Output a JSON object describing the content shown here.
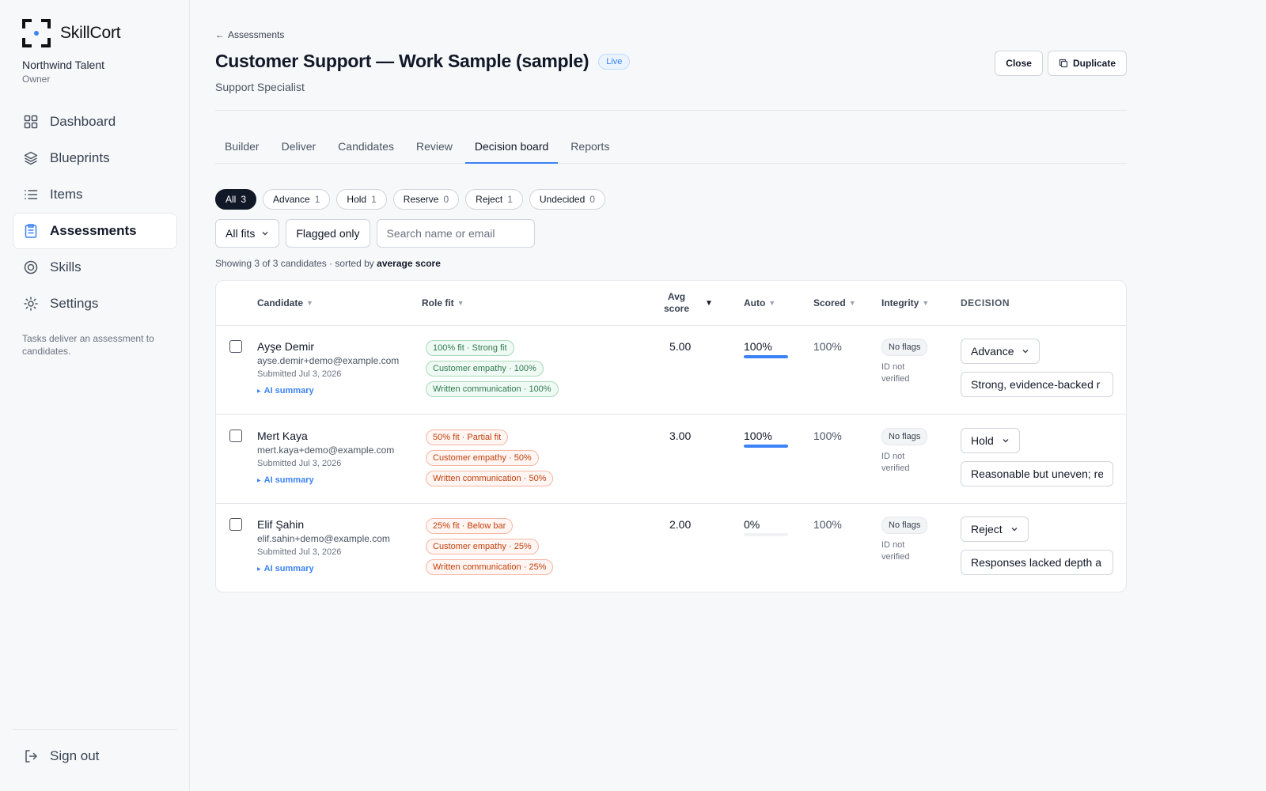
{
  "app": {
    "name": "SkillCort",
    "org_name": "Northwind Talent",
    "org_role": "Owner",
    "accent_color": "#3b82f6"
  },
  "sidebar": {
    "items": [
      {
        "label": "Dashboard",
        "icon": "grid-icon"
      },
      {
        "label": "Blueprints",
        "icon": "layers-icon"
      },
      {
        "label": "Items",
        "icon": "list-icon"
      },
      {
        "label": "Assessments",
        "icon": "clipboard-icon",
        "active": true
      },
      {
        "label": "Skills",
        "icon": "target-icon"
      },
      {
        "label": "Settings",
        "icon": "gear-icon"
      }
    ],
    "note": "Tasks deliver an assessment to candidates.",
    "signout": "Sign out"
  },
  "header": {
    "back_label": "Assessments",
    "title": "Customer Support — Work Sample (sample)",
    "status_badge": "Live",
    "subtitle": "Support Specialist",
    "close_label": "Close",
    "duplicate_label": "Duplicate"
  },
  "tabs": [
    "Builder",
    "Deliver",
    "Candidates",
    "Review",
    "Decision board",
    "Reports"
  ],
  "active_tab": "Decision board",
  "chips": [
    {
      "label": "All",
      "count": "3",
      "active": true
    },
    {
      "label": "Advance",
      "count": "1"
    },
    {
      "label": "Hold",
      "count": "1"
    },
    {
      "label": "Reserve",
      "count": "0"
    },
    {
      "label": "Reject",
      "count": "1"
    },
    {
      "label": "Undecided",
      "count": "0"
    }
  ],
  "filters": {
    "fit_select": "All fits",
    "flagged": "Flagged only",
    "search_placeholder": "Search name or email"
  },
  "showing": {
    "prefix": "Showing 3 of 3 candidates · sorted by",
    "sort_key": "average score"
  },
  "table": {
    "headers": {
      "candidate": "Candidate",
      "role_fit": "Role fit",
      "avg_line1": "Avg",
      "avg_line2": "score",
      "auto": "Auto",
      "scored": "Scored",
      "integrity": "Integrity",
      "decision": "DECISION"
    },
    "rows": [
      {
        "name": "Ayşe Demir",
        "email": "ayse.demir+demo@example.com",
        "submitted": "Submitted Jul 3, 2026",
        "ai_label": "AI summary",
        "fit_tone": "green",
        "fits": [
          "100% fit · Strong fit",
          "Customer empathy · 100%",
          "Written communication · 100%"
        ],
        "avg": "5.00",
        "auto": "100%",
        "auto_fraction": 1.0,
        "scored": "100%",
        "integrity_badge": "No flags",
        "integrity_note": "ID not verified",
        "decision": "Advance",
        "decision_note": "Strong, evidence-backed r"
      },
      {
        "name": "Mert Kaya",
        "email": "mert.kaya+demo@example.com",
        "submitted": "Submitted Jul 3, 2026",
        "ai_label": "AI summary",
        "fit_tone": "red",
        "fits": [
          "50% fit · Partial fit",
          "Customer empathy · 50%",
          "Written communication · 50%"
        ],
        "avg": "3.00",
        "auto": "100%",
        "auto_fraction": 1.0,
        "scored": "100%",
        "integrity_badge": "No flags",
        "integrity_note": "ID not verified",
        "decision": "Hold",
        "decision_note": "Reasonable but uneven; re"
      },
      {
        "name": "Elif Şahin",
        "email": "elif.sahin+demo@example.com",
        "submitted": "Submitted Jul 3, 2026",
        "ai_label": "AI summary",
        "fit_tone": "red",
        "fits": [
          "25% fit · Below bar",
          "Customer empathy · 25%",
          "Written communication · 25%"
        ],
        "avg": "2.00",
        "auto": "0%",
        "auto_fraction": 0.0,
        "scored": "100%",
        "integrity_badge": "No flags",
        "integrity_note": "ID not verified",
        "decision": "Reject",
        "decision_note": "Responses lacked depth a"
      }
    ]
  }
}
